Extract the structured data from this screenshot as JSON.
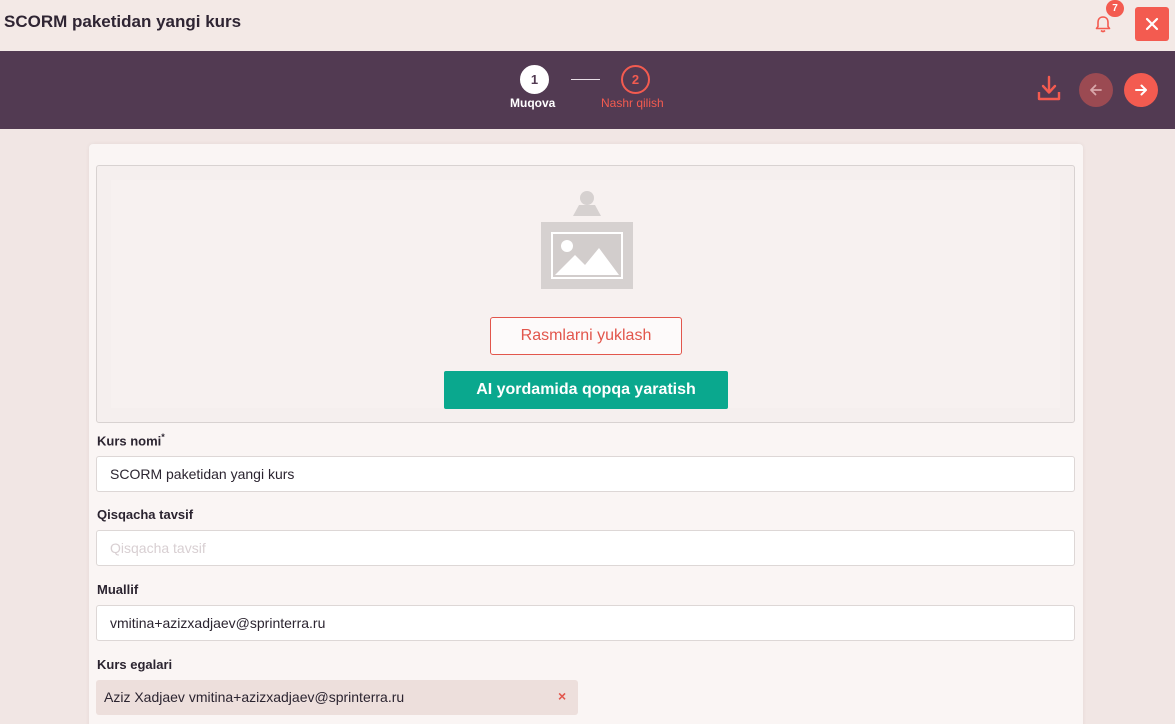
{
  "window": {
    "title": "SCORM paketidan yangi kurs",
    "notifications_count": "7"
  },
  "stepper": {
    "steps": [
      {
        "number": "1",
        "label": "Muqova",
        "state": "active"
      },
      {
        "number": "2",
        "label": "Nashr qilish",
        "state": "pending"
      }
    ]
  },
  "cover": {
    "upload_label": "Rasmlarni yuklash",
    "ai_label": "AI yordamida qopqa yaratish"
  },
  "form": {
    "course_name": {
      "label": "Kurs nomi",
      "required_mark": "*",
      "value": "SCORM paketidan yangi kurs"
    },
    "short_description": {
      "label": "Qisqacha tavsif",
      "placeholder": "Qisqacha tavsif",
      "value": ""
    },
    "author": {
      "label": "Muallif",
      "value": "vmitina+azizxadjaev@sprinterra.ru"
    },
    "owners": {
      "label": "Kurs egalari",
      "items": [
        "Aziz Xadjaev vmitina+azizxadjaev@sprinterra.ru"
      ]
    }
  },
  "icons": [
    "bell-icon",
    "close-icon",
    "download-icon",
    "arrow-left-icon",
    "arrow-right-icon",
    "image-placeholder-icon",
    "remove-icon"
  ],
  "colors": {
    "accent": "#f35b50",
    "header": "#523a52",
    "ai_button": "#0aa88e"
  }
}
